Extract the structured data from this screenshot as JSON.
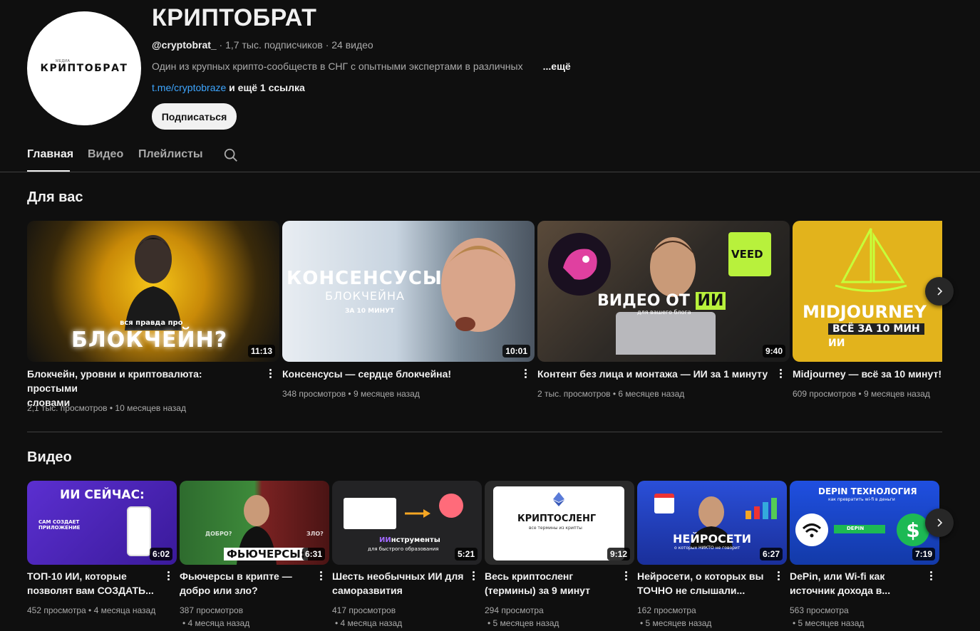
{
  "channel": {
    "title": "КРИПТОБРАТ",
    "handle": "@cryptobrat_",
    "stats": " · 1,7 тыс. подписчиков · 24 видео",
    "description": "Один из крупных крипто-сообществ в СНГ с опытными экспертами в различных",
    "more": "...ещё",
    "link": "t.me/cryptobraze",
    "link_more": " и ещё 1 ссылка",
    "subscribe": "Подписаться",
    "avatar_text": "КРИПТОБРАТ",
    "avatar_small": "МЕДИА"
  },
  "tabs": [
    "Главная",
    "Видео",
    "Плейлисты"
  ],
  "sections": {
    "for_you": "Для вас",
    "videos": "Видео"
  },
  "for_you": [
    {
      "title_l1": "Блокчейн, уровни и криптовалюта: простыми",
      "title_l2": "словами",
      "meta": "2,1 тыс. просмотров • 10 месяцев назад",
      "duration": "11:13",
      "thumb_top": "вся правда про",
      "thumb_main": "БЛОКЧЕЙН?"
    },
    {
      "title_l1": "Консенсусы — сердце блокчейна!",
      "title_l2": "",
      "meta": "348 просмотров • 9 месяцев назад",
      "duration": "10:01",
      "thumb_main": "КОНСЕНСУСЫ",
      "thumb_sub": "БЛОКЧЕЙНА",
      "thumb_small": "ЗА 10 МИНУТ"
    },
    {
      "title_l1": "Контент без лица и монтажа — ИИ за 1 минуту",
      "title_l2": "",
      "meta": "2 тыс. просмотров • 6 месяцев назад",
      "duration": "9:40",
      "thumb_main": "ВИДЕО ОТ",
      "thumb_hl": "ИИ",
      "thumb_sub": "для вашего блога",
      "thumb_badge": "VEED"
    },
    {
      "title_l1": "Midjourney — всё за 10 минут!",
      "title_l2": "",
      "meta": "609 просмотров • 9 месяцев назад",
      "duration": "",
      "thumb_main": "MIDJOURNEY",
      "thumb_sub": "ВСЁ ЗА 10 МИН",
      "thumb_hl": "ИИ"
    }
  ],
  "videos": [
    {
      "title_l1": "ТОП-10 ИИ, которые",
      "title_l2": "позволят вам СОЗДАТЬ...",
      "meta_l1": "452 просмотра • 4 месяца назад",
      "meta_l2": "",
      "duration": "6:02",
      "thumb_main": "ИИ СЕЙЧАС:",
      "thumb_sub": "САМ СОЗДАЕТ ПРИЛОЖЕНИЕ"
    },
    {
      "title_l1": "Фьючерсы в крипте —",
      "title_l2": "добро или зло?",
      "meta_l1": "387 просмотров",
      "meta_l2": "• 4 месяца назад",
      "duration": "6:31",
      "thumb_main": "ФЬЮЧЕРСЫ:",
      "thumb_left": "ДОБРО?",
      "thumb_right": "ЗЛО?"
    },
    {
      "title_l1": "Шесть необычных ИИ для",
      "title_l2": "саморазвития",
      "meta_l1": "417 просмотров",
      "meta_l2": "• 4 месяца назад",
      "duration": "5:21",
      "thumb_hl": "ИИ",
      "thumb_main": "нструменты",
      "thumb_sub": "для быстрого образования"
    },
    {
      "title_l1": "Весь криптосленг",
      "title_l2": "(термины) за 9 минут",
      "meta_l1": "294 просмотра",
      "meta_l2": "• 5 месяцев назад",
      "duration": "9:12",
      "thumb_main": "КРИПТОСЛЕНГ",
      "thumb_sub": "все термины из крипты"
    },
    {
      "title_l1": "Нейросети, о которых вы",
      "title_l2": "ТОЧНО не слышали...",
      "meta_l1": "162 просмотра",
      "meta_l2": "• 5 месяцев назад",
      "duration": "6:27",
      "thumb_main": "НЕЙРОСЕТИ",
      "thumb_sub": "о которых НИКТО не говорит"
    },
    {
      "title_l1": "DePin, или Wi-fi как",
      "title_l2": "источник дохода в...",
      "meta_l1": "563 просмотра",
      "meta_l2": "• 5 месяцев назад",
      "duration": "7:19",
      "thumb_main": "DEPIN ТЕХНОЛОГИЯ",
      "thumb_sub": "как превратить wi-fi в деньги",
      "thumb_badge": "DEPIN"
    }
  ]
}
